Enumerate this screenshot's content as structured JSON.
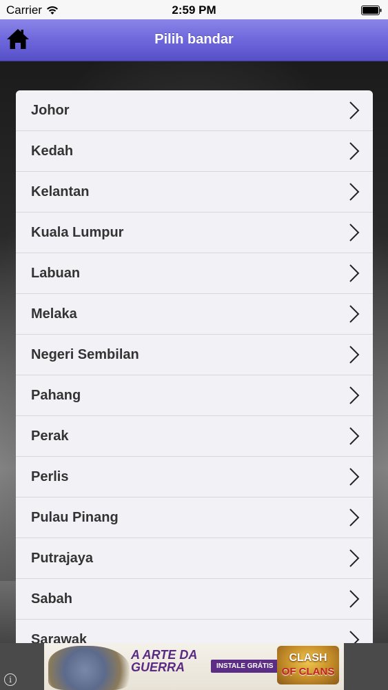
{
  "status_bar": {
    "carrier": "Carrier",
    "time": "2:59 PM"
  },
  "nav": {
    "title": "Pilih bandar",
    "home_icon": "home-icon"
  },
  "states": [
    {
      "label": "Johor"
    },
    {
      "label": "Kedah"
    },
    {
      "label": "Kelantan"
    },
    {
      "label": "Kuala Lumpur"
    },
    {
      "label": "Labuan"
    },
    {
      "label": "Melaka"
    },
    {
      "label": "Negeri Sembilan"
    },
    {
      "label": "Pahang"
    },
    {
      "label": "Perak"
    },
    {
      "label": "Perlis"
    },
    {
      "label": "Pulau Pinang"
    },
    {
      "label": "Putrajaya"
    },
    {
      "label": "Sabah"
    },
    {
      "label": "Sarawak"
    }
  ],
  "ad": {
    "headline": "A ARTE DA GUERRA",
    "install_label": "INSTALE GRÁTIS",
    "logo_top": "CLASH",
    "logo_bottom": "OF CLANS",
    "info_glyph": "i"
  },
  "colors": {
    "nav_top": "#8a85e8",
    "nav_bottom": "#5650c8",
    "list_bg": "#f2f1f6",
    "label_text": "#333333",
    "ad_accent": "#5b2d85"
  }
}
